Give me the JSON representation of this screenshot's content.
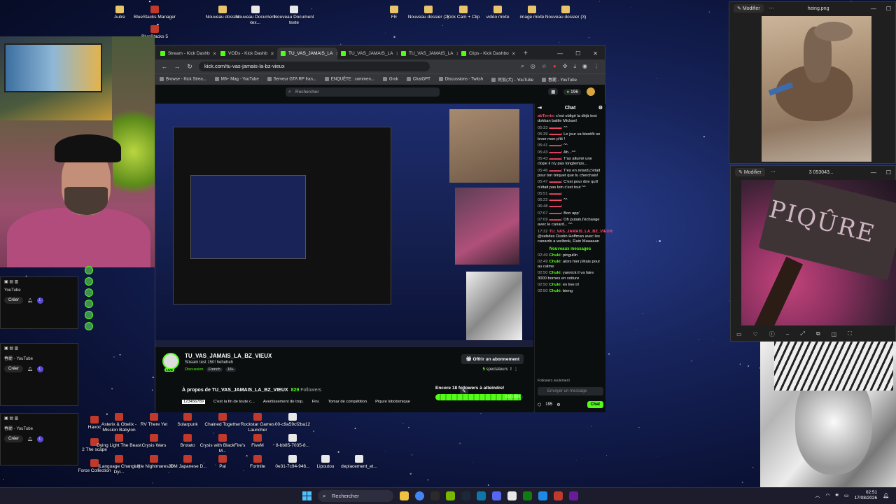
{
  "desktop": {
    "top_icons": [
      {
        "label": "Autre",
        "type": "folder"
      },
      {
        "label": "BlueStacks Manager",
        "type": "app"
      },
      {
        "label": "BlueStacks 5",
        "type": "app"
      },
      {
        "label": "Nouveau dossier",
        "type": "folder"
      },
      {
        "label": "Nouveau Document tex...",
        "type": "doc"
      },
      {
        "label": "Nouveau Document texte",
        "type": "doc"
      },
      {
        "label": "FE",
        "type": "folder"
      },
      {
        "label": "Nouveau dossier (2)",
        "type": "folder"
      },
      {
        "label": "Kick Cam + Clip",
        "type": "folder"
      },
      {
        "label": "vidéo mixte",
        "type": "folder"
      },
      {
        "label": "image mixte",
        "type": "folder"
      },
      {
        "label": "Nouveau dossier (3)",
        "type": "folder"
      }
    ],
    "bottom_icons": [
      {
        "label": "Havoc",
        "type": "app"
      },
      {
        "label": "Asterix & Obelix - Mission Babylon",
        "type": "app"
      },
      {
        "label": "RV There Yet",
        "type": "app"
      },
      {
        "label": "Solarpunk",
        "type": "app"
      },
      {
        "label": "Chained Together",
        "type": "app"
      },
      {
        "label": "Rockstar Games Launcher",
        "type": "app"
      },
      {
        "label": "00-c9a59cf2ba12",
        "type": "doc"
      },
      {
        "label": "2 The scape",
        "type": "app"
      },
      {
        "label": "Dying Light The Beast",
        "type": "app"
      },
      {
        "label": "Crysis Wars",
        "type": "app"
      },
      {
        "label": "Brotato",
        "type": "app"
      },
      {
        "label": "Crysis with BlackFire's M...",
        "type": "app"
      },
      {
        "label": "FiveM",
        "type": "app"
      },
      {
        "label": "8-bb85-7035-8...",
        "type": "doc"
      },
      {
        "label": "Force Collection",
        "type": "app"
      },
      {
        "label": "[Language Changer] Dyi...",
        "type": "app"
      },
      {
        "label": "Little Nightmares III",
        "type": "app"
      },
      {
        "label": "JDM Japanese D...",
        "type": "app"
      },
      {
        "label": "Pal",
        "type": "app"
      },
      {
        "label": "Fortnite",
        "type": "app"
      },
      {
        "label": "0e31-7c94-946...",
        "type": "doc"
      },
      {
        "label": "Lipoutou",
        "type": "doc"
      },
      {
        "label": "deplacement_et...",
        "type": "doc"
      }
    ]
  },
  "left_fragments": [
    {
      "label": "YouTube",
      "create": "Créer",
      "avatar": "L"
    },
    {
      "label": "春麗 - YouTube",
      "create": "Créer",
      "avatar": "L"
    },
    {
      "label": "春麗 - YouTube",
      "create": "Créer",
      "avatar": "L"
    }
  ],
  "browser": {
    "tabs": [
      {
        "label": "Stream - Kick Dashb",
        "active": false
      },
      {
        "label": "VODs - Kick Dashb",
        "active": false
      },
      {
        "label": "TU_VAS_JAMAIS_LA",
        "active": true
      },
      {
        "label": "TU_VAS_JAMAIS_LA",
        "active": false
      },
      {
        "label": "TU_VAS_JAMAIS_LA",
        "active": false
      },
      {
        "label": "Clips - Kick Dashbo",
        "active": false
      }
    ],
    "new_tab": "+",
    "url": "kick.com/tu-vas-jamais-la-bz-vieux",
    "bookmarks": [
      "Browse - Kick Strea...",
      "M6+ Mag - YouTube",
      "Serveur GTA RP fran...",
      "ENQUÊTE : commen...",
      "Grok",
      "ChatGPT",
      "Discussions - Twitch",
      "死仮(犬) - YouTube",
      "春麗 - YouTube"
    ]
  },
  "kick": {
    "search_placeholder": "Rechercher",
    "viewer_pill": "196",
    "channel": {
      "name": "TU_VAS_JAMAIS_LA_BZ_VIEUX",
      "title": "Stream test 150! heheheh",
      "category": "Discussion",
      "tags": [
        "French",
        "18+"
      ],
      "live_badge": "LIVE",
      "subscribe": "Offrir un abonnement",
      "viewers_count": "5",
      "viewers_label": "spectateurs",
      "about_prefix": "À propos de TU_VAS_JAMAIS_LA_BZ_VIEUX",
      "followers_count": "829",
      "followers_label": "Followers"
    },
    "pinned": [
      "123456789",
      "C'est la fin de toute c...",
      "Avertissement de trop.",
      "Fini.",
      "Tomar de compétition",
      "Piqure lobotomique"
    ],
    "goal": {
      "title": "Encore 18 followers à atteindre!",
      "current": 832,
      "target": 850,
      "label": "832 / 850"
    },
    "chat": {
      "title": "Chat",
      "messages": [
        {
          "time": "",
          "user": "abTerrin",
          "text": "c'est obligé la déjà test dokkan battle Mickael"
        },
        {
          "time": "05:33",
          "user": "",
          "text": "^^"
        },
        {
          "time": "05:39",
          "user": "",
          "text": "Le jour va bientôt se lever mon p'tit !"
        },
        {
          "time": "05:41",
          "user": "",
          "text": "^^"
        },
        {
          "time": "05:43",
          "user": "",
          "text": "Ah...^^"
        },
        {
          "time": "05:43",
          "user": "",
          "text": "T'as allumé une clope il n'y pas longtemps..."
        },
        {
          "time": "05:46",
          "user": "",
          "text": "T'es en retard,c'était pour ton briquet que tu cherchais!"
        },
        {
          "time": "05:47",
          "user": "",
          "text": "C'est pour dire qu'il n'était pas loin c'est tout ^^"
        },
        {
          "time": "05:51",
          "user": "",
          "text": ""
        },
        {
          "time": "06:22",
          "user": "",
          "text": "^^"
        },
        {
          "time": "06:48",
          "user": "",
          "text": ""
        },
        {
          "time": "07:07",
          "user": "",
          "text": "Bon app'"
        },
        {
          "time": "07:09",
          "user": "",
          "text": "Oh putain,l'échange avec le canard... ^^"
        },
        {
          "time": "17:32",
          "user": "TU_VAS_JAMAIS_LA_BZ_VIEUX",
          "text": "@sebdes Dustin Hoffman avec les canards a welbrok, Rain Maaaaan"
        }
      ],
      "new_messages": "Nouveaux messages",
      "new": [
        {
          "time": "02:49",
          "user": "Chuki",
          "text": "pinguilin"
        },
        {
          "time": "02:49",
          "user": "Chuki",
          "text": "alors hier j'étais pour au calme"
        },
        {
          "time": "02:50",
          "user": "Chuki",
          "text": "yannick il va faire 3000 bornes en voiture"
        },
        {
          "time": "02:50",
          "user": "Chuki",
          "text": "en live irl"
        },
        {
          "time": "02:50",
          "user": "Chuki",
          "text": "bieng"
        }
      ],
      "followers_only": "Followers seulement",
      "input_placeholder": "Envoyer un message",
      "points": "195",
      "send": "Chat"
    }
  },
  "viewer_duck": {
    "edit": "Modifier",
    "filename": "heing.png"
  },
  "viewer_piq": {
    "edit": "Modifier",
    "filename": "3 053043...",
    "sign_text": "PIQÛRE"
  },
  "taskbar": {
    "search": "Rechercher",
    "time": "02:51",
    "date": "17/08/2026"
  },
  "colors": {
    "kick_green": "#53fc18",
    "windows_blue": "#4cc2ff"
  }
}
